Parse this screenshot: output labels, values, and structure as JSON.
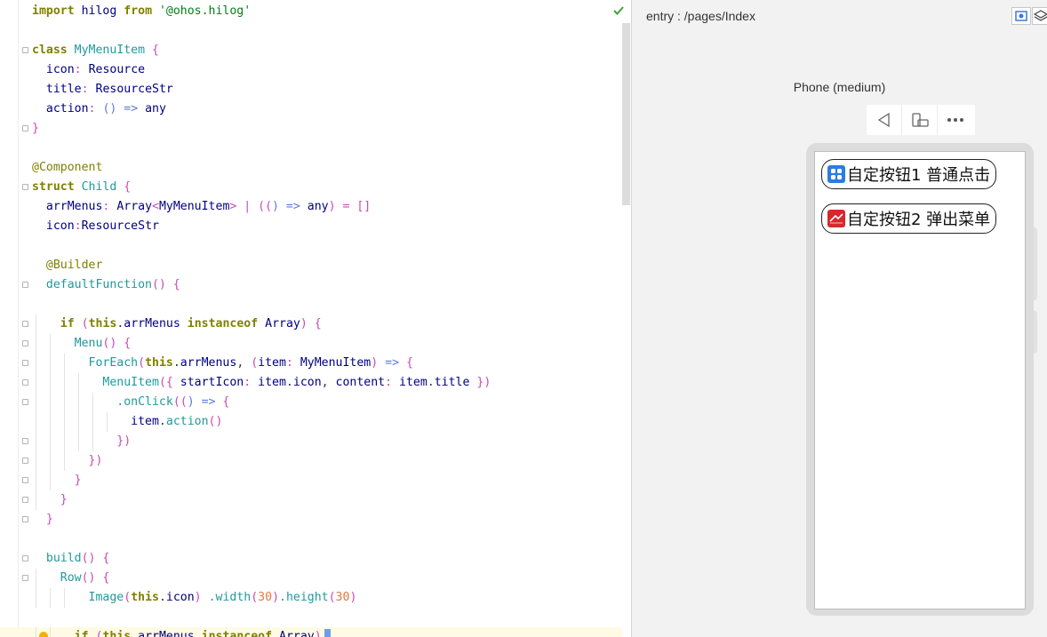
{
  "editor": {
    "lines": [
      {
        "fold": false,
        "html": "<span class=\"kw2\">import</span> <span class=\"id\">hilog</span> <span class=\"kw2\">from</span> <span class=\"str\">'@ohos.hilog'</span>"
      },
      {
        "fold": false,
        "html": ""
      },
      {
        "fold": true,
        "html": "<span class=\"kw2\">class</span> <span class=\"cls\">MyMenuItem</span> <span class=\"pun\">{</span>"
      },
      {
        "fold": false,
        "html": "  <span class=\"id\">icon</span><span class=\"pun\">:</span> <span class=\"id\">Resource</span>"
      },
      {
        "fold": false,
        "html": "  <span class=\"id\">title</span><span class=\"pun\">:</span> <span class=\"id\">ResourceStr</span>"
      },
      {
        "fold": false,
        "html": "  <span class=\"id\">action</span><span class=\"pun\">:</span> <span class=\"op\">() =&gt;</span> <span class=\"id\">any</span>"
      },
      {
        "fold": true,
        "html": "<span class=\"pun\">}</span>"
      },
      {
        "fold": false,
        "html": ""
      },
      {
        "fold": false,
        "html": "<span class=\"ann\">@Component</span>"
      },
      {
        "fold": true,
        "html": "<span class=\"kw2\">struct</span> <span class=\"cls\">Child</span> <span class=\"pun\">{</span>"
      },
      {
        "fold": false,
        "html": "  <span class=\"id\">arrMenus</span><span class=\"pun\">:</span> <span class=\"id\">Array</span><span class=\"pun\">&lt;</span><span class=\"id\">MyMenuItem</span><span class=\"pun\">&gt; | ((</span><span class=\"op\">) =&gt;</span> <span class=\"id\">any</span><span class=\"pun\">) = []</span>"
      },
      {
        "fold": false,
        "html": "  <span class=\"id\">icon</span><span class=\"pun\">:</span><span class=\"id\">ResourceStr</span>"
      },
      {
        "fold": false,
        "html": ""
      },
      {
        "fold": false,
        "html": "  <span class=\"ann\">@Builder</span>"
      },
      {
        "fold": true,
        "html": "  <span class=\"cls\">defaultFunction</span><span class=\"pun\">() {</span>"
      },
      {
        "fold": false,
        "html": ""
      },
      {
        "fold": true,
        "html": "    <span class=\"kw2\">if</span> <span class=\"pun\">(</span><span class=\"kw2\">this</span>.<span class=\"id\">arrMenus</span> <span class=\"kw2\">instanceof</span> <span class=\"id\">Array</span><span class=\"pun\">) {</span>"
      },
      {
        "fold": true,
        "html": "      <span class=\"cls\">Menu</span><span class=\"pun\">() {</span>"
      },
      {
        "fold": true,
        "html": "        <span class=\"cls\">ForEach</span><span class=\"pun\">(</span><span class=\"kw2\">this</span>.<span class=\"id\">arrMenus</span>, <span class=\"pun\">(</span><span class=\"id\">item</span><span class=\"pun\">:</span> <span class=\"id\">MyMenuItem</span><span class=\"pun\">)</span> <span class=\"op\">=&gt;</span> <span class=\"pun\">{</span>"
      },
      {
        "fold": true,
        "html": "          <span class=\"cls\">MenuItem</span><span class=\"pun\">({</span> <span class=\"id\">startIcon</span><span class=\"pun\">:</span> <span class=\"id\">item</span>.<span class=\"id\">icon</span>, <span class=\"id\">content</span><span class=\"pun\">:</span> <span class=\"id\">item</span>.<span class=\"id\">title</span> <span class=\"pun\">})</span>"
      },
      {
        "fold": true,
        "html": "            <span class=\"cls\">.onClick</span><span class=\"pun\">((</span><span class=\"op\">) =&gt;</span> <span class=\"pun\">{</span>"
      },
      {
        "fold": false,
        "html": "              <span class=\"id\">item</span>.<span class=\"cls\">action</span><span class=\"pun\">()</span>"
      },
      {
        "fold": true,
        "html": "            <span class=\"pun\">})</span>"
      },
      {
        "fold": true,
        "html": "        <span class=\"pun\">})</span>"
      },
      {
        "fold": true,
        "html": "      <span class=\"pun\">}</span>"
      },
      {
        "fold": true,
        "html": "    <span class=\"pun\">}</span>"
      },
      {
        "fold": true,
        "html": "  <span class=\"pun\">}</span>"
      },
      {
        "fold": false,
        "html": ""
      },
      {
        "fold": true,
        "html": "  <span class=\"cls\">build</span><span class=\"pun\">() {</span>"
      },
      {
        "fold": true,
        "html": "    <span class=\"cls\">Row</span><span class=\"pun\">() {</span>"
      },
      {
        "fold": false,
        "html": "        <span class=\"cls\">Image</span><span class=\"pun\">(</span><span class=\"kw2\">this</span>.<span class=\"id\">icon</span><span class=\"pun\">)</span> <span class=\"cls\">.width</span><span class=\"pun\">(</span><span class=\"num\">30</span><span class=\"pun\">)</span><span class=\"cls\">.height</span><span class=\"pun\">(</span><span class=\"num\">30</span><span class=\"pun\">)</span>"
      },
      {
        "fold": false,
        "html": ""
      },
      {
        "fold": false,
        "current": true,
        "html": "      <span class=\"kw2\">if</span> <span class=\"pun\">(</span><span class=\"kw2\">this</span>.<span class=\"id\">arrMenus</span> <span class=\"kw2\">instanceof</span> <span class=\"id\">Array</span><span class=\"pun\">)</span>"
      }
    ]
  },
  "preview": {
    "route": "entry : /pages/Index",
    "device_name": "Phone (medium)",
    "buttons": [
      {
        "label": "自定按钮1 普通点击",
        "icon": "app-grid-icon",
        "color": "#2a7de1"
      },
      {
        "label": "自定按钮2 弹出菜单",
        "icon": "red-app-icon",
        "color": "#d9272e"
      }
    ]
  }
}
